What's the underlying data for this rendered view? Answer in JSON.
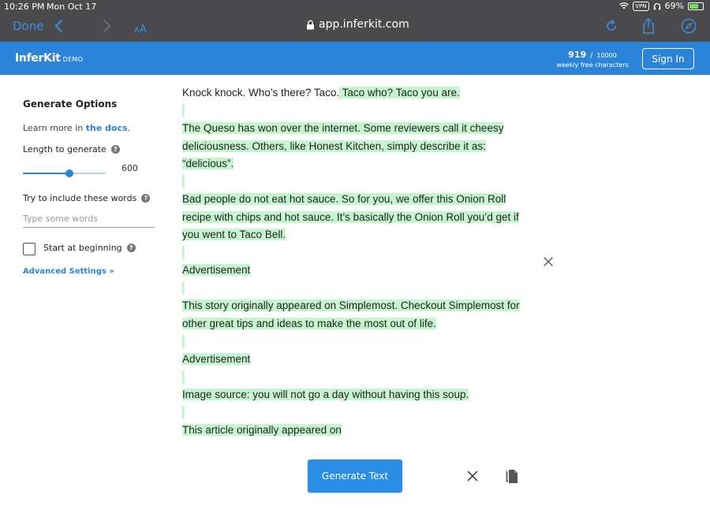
{
  "status_bar": {
    "time": "10:26 PM",
    "date": "Mon Oct 17",
    "vpn": "VPN",
    "battery_percent": "69%",
    "battery_level": 0.69
  },
  "browser": {
    "done_label": "Done",
    "url": "app.inferkit.com",
    "accent_color": "#3a8ee6",
    "icons": [
      "chevron-left-icon",
      "chevron-right-icon",
      "text-size-icon",
      "lock-icon",
      "reload-icon",
      "share-icon",
      "compass-icon"
    ]
  },
  "header": {
    "brand": "InferKit",
    "brand_tag": "DEMO",
    "counter_used": "919",
    "counter_separator": "/",
    "counter_limit": "10000",
    "counter_caption": "weekly free characters",
    "signin_label": "Sign In",
    "brand_color": "#2c84d8"
  },
  "sidebar": {
    "title": "Generate Options",
    "learn_prefix": "Learn more in ",
    "docs_link": "the docs",
    "learn_suffix": ".",
    "length_label": "Length to generate",
    "length_value": "600",
    "length_fraction": 0.56,
    "words_label": "Try to include these words",
    "words_placeholder": "Type some words",
    "words_value": "",
    "start_label": "Start at beginning",
    "start_checked": false,
    "advanced_label": "Advanced Settings »"
  },
  "editor": {
    "prompt": "Knock knock. Who’s there? Taco.",
    "first_generated": " Taco who? Taco you are.",
    "paragraphs": [
      "The Queso has won over the internet. Some reviewers call it cheesy deliciousness. Others, like Honest Kitchen, simply describe it as: “delicious”.",
      "Bad people do not eat hot sauce. So for you, we offer this Onion Roll recipe with chips and hot sauce. It’s basically the Onion Roll you’d get if you went to Taco Bell.",
      "Advertisement",
      "This story originally appeared on Simplemost. Checkout Simplemost for other great tips and ideas to make the most out of life.",
      "Advertisement",
      "Image source: you will not go a day without having this soup.",
      "This article originally appeared on"
    ],
    "highlight_color": "#c6f6cf"
  },
  "actions": {
    "generate_label": "Generate Text",
    "icons": [
      "close-icon",
      "copy-icon"
    ]
  }
}
